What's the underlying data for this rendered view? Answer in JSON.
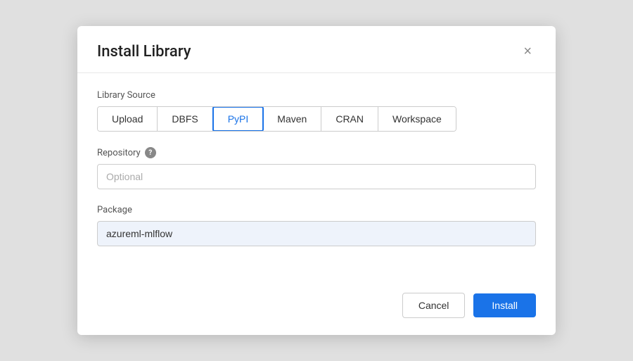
{
  "dialog": {
    "title": "Install Library",
    "close_label": "×"
  },
  "library_source": {
    "label": "Library Source",
    "tabs": [
      {
        "id": "upload",
        "label": "Upload",
        "active": false
      },
      {
        "id": "dbfs",
        "label": "DBFS",
        "active": false
      },
      {
        "id": "pypi",
        "label": "PyPI",
        "active": true
      },
      {
        "id": "maven",
        "label": "Maven",
        "active": false
      },
      {
        "id": "cran",
        "label": "CRAN",
        "active": false
      },
      {
        "id": "workspace",
        "label": "Workspace",
        "active": false
      }
    ]
  },
  "repository": {
    "label": "Repository",
    "placeholder": "Optional",
    "value": ""
  },
  "package": {
    "label": "Package",
    "placeholder": "",
    "value": "azureml-mlflow"
  },
  "footer": {
    "cancel_label": "Cancel",
    "install_label": "Install"
  }
}
